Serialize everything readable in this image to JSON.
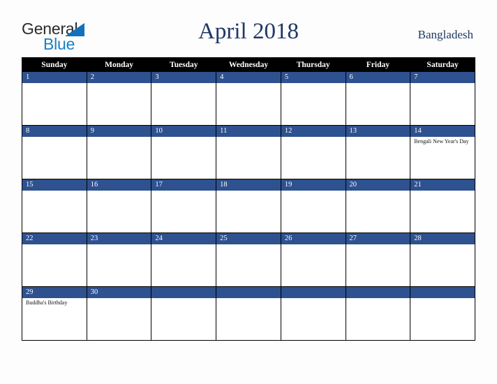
{
  "brand": {
    "line1": "General",
    "line2": "Blue",
    "triangle_color": "#1271bd",
    "line2_color": "#1b7fc4",
    "icon": "triangle-icon"
  },
  "header": {
    "title": "April 2018",
    "region": "Bangladesh",
    "title_color": "#1f3864"
  },
  "calendar": {
    "weekday_headers": [
      "Sunday",
      "Monday",
      "Tuesday",
      "Wednesday",
      "Thursday",
      "Friday",
      "Saturday"
    ],
    "header_bg": "#000000",
    "day_bar_bg": "#2e5190",
    "cell_bg": "#ffffff",
    "weeks": [
      {
        "days": [
          {
            "number": "1",
            "events": []
          },
          {
            "number": "2",
            "events": []
          },
          {
            "number": "3",
            "events": []
          },
          {
            "number": "4",
            "events": []
          },
          {
            "number": "5",
            "events": []
          },
          {
            "number": "6",
            "events": []
          },
          {
            "number": "7",
            "events": []
          }
        ]
      },
      {
        "days": [
          {
            "number": "8",
            "events": []
          },
          {
            "number": "9",
            "events": []
          },
          {
            "number": "10",
            "events": []
          },
          {
            "number": "11",
            "events": []
          },
          {
            "number": "12",
            "events": []
          },
          {
            "number": "13",
            "events": []
          },
          {
            "number": "14",
            "events": [
              "Bengali New Year's Day"
            ]
          }
        ]
      },
      {
        "days": [
          {
            "number": "15",
            "events": []
          },
          {
            "number": "16",
            "events": []
          },
          {
            "number": "17",
            "events": []
          },
          {
            "number": "18",
            "events": []
          },
          {
            "number": "19",
            "events": []
          },
          {
            "number": "20",
            "events": []
          },
          {
            "number": "21",
            "events": []
          }
        ]
      },
      {
        "days": [
          {
            "number": "22",
            "events": []
          },
          {
            "number": "23",
            "events": []
          },
          {
            "number": "24",
            "events": []
          },
          {
            "number": "25",
            "events": []
          },
          {
            "number": "26",
            "events": []
          },
          {
            "number": "27",
            "events": []
          },
          {
            "number": "28",
            "events": []
          }
        ]
      },
      {
        "days": [
          {
            "number": "29",
            "events": [
              "Buddha's Birthday"
            ]
          },
          {
            "number": "30",
            "events": []
          },
          {
            "number": "",
            "events": []
          },
          {
            "number": "",
            "events": []
          },
          {
            "number": "",
            "events": []
          },
          {
            "number": "",
            "events": []
          },
          {
            "number": "",
            "events": []
          }
        ]
      }
    ]
  }
}
